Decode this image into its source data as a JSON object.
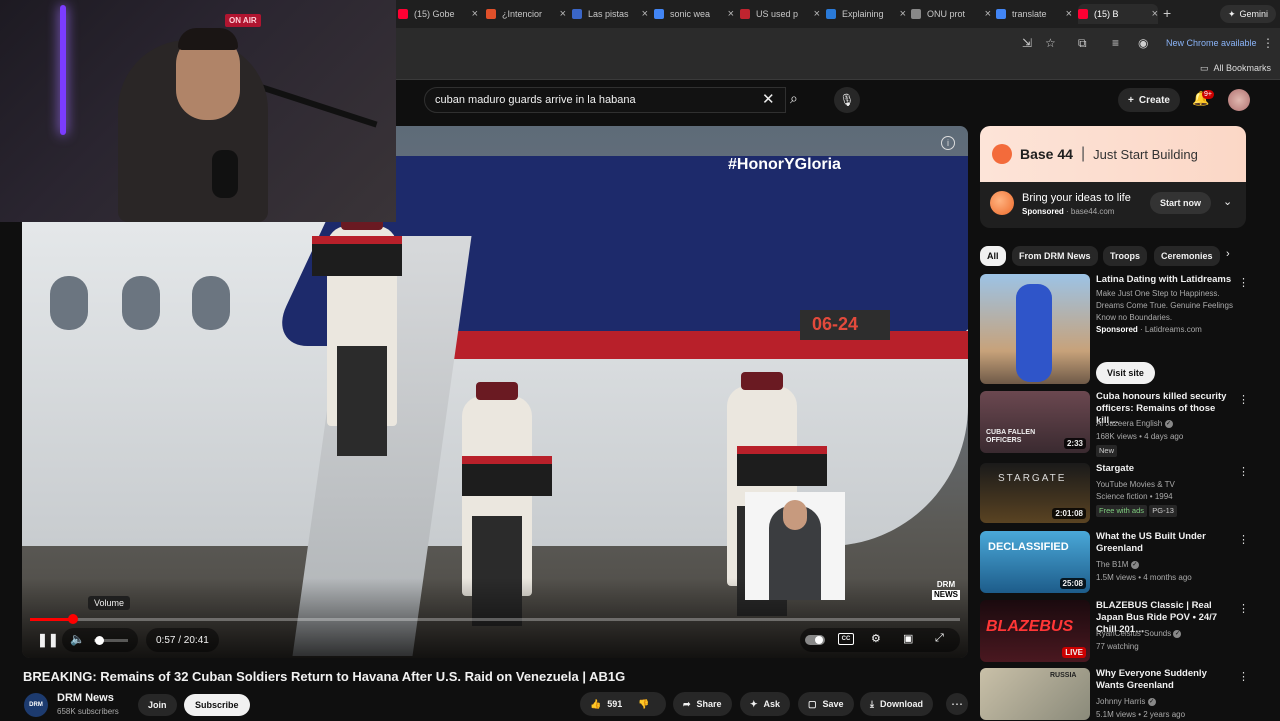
{
  "browser": {
    "tabs": [
      {
        "label": "(15) Gobe",
        "color": "#ff0033",
        "active": false
      },
      {
        "label": "¿Intencior",
        "color": "#e0502a",
        "active": false
      },
      {
        "label": "Las pistas",
        "color": "#3a66c8",
        "active": false
      },
      {
        "label": "sonic wea",
        "color": "#4285f4",
        "active": false
      },
      {
        "label": "US used p",
        "color": "#c0242f",
        "active": false
      },
      {
        "label": "Explaining",
        "color": "#2a7ad8",
        "active": false
      },
      {
        "label": "ONU prot",
        "color": "#888888",
        "active": false
      },
      {
        "label": "translate",
        "color": "#4285f4",
        "active": false
      },
      {
        "label": "(15) B",
        "color": "#ff0033",
        "active": true
      }
    ],
    "new_tab": "+",
    "gemini_label": "Gemini",
    "new_chrome": "New Chrome available",
    "all_bookmarks": "All Bookmarks",
    "close_glyph": "×"
  },
  "overlay": {
    "on_air": "ON AIR"
  },
  "youtube": {
    "search": {
      "value": "cuban maduro guards arrive in la habana"
    },
    "create_label": "Create",
    "notifications_badge": "9+"
  },
  "player": {
    "hashtag": "#HonorYGloria",
    "tail_number": "06-24",
    "watermark_top": "DRM",
    "watermark_bottom": "NEWS",
    "volume_tooltip": "Volume",
    "time": "0:57 / 20:41",
    "progress": 0.046,
    "volume": 0.15,
    "cc_label": "CC"
  },
  "video": {
    "title": "BREAKING: Remains of 32 Cuban Soldiers Return to Havana After U.S. Raid on Venezuela | AB1G",
    "channel": "DRM News",
    "channel_avatar": "DRM",
    "subscribers": "658K subscribers",
    "join": "Join",
    "subscribe": "Subscribe",
    "likes": "591",
    "share": "Share",
    "ask": "Ask",
    "save": "Save",
    "download": "Download"
  },
  "ad": {
    "brand": "Base 44",
    "separator": "|",
    "tagline": "Just Start Building",
    "title": "Bring your ideas to life",
    "sponsored": "Sponsored",
    "domain": "base44.com",
    "cta": "Start now"
  },
  "chips": [
    "All",
    "From DRM News",
    "Troops",
    "Ceremonies"
  ],
  "recommendations": [
    {
      "title": "Latina Dating with Latidreams",
      "desc": "Make Just One Step to Happiness. Dreams Come True. Genuine Feelings Know no Boundaries.",
      "sponsored": "Sponsored",
      "domain": "Latidreams.com",
      "cta": "Visit site"
    },
    {
      "title": "Cuba honours killed security officers: Remains of those kill…",
      "channel": "Al Jazeera English",
      "meta": "168K views • 4 days ago",
      "badge": "New",
      "duration": "2:33",
      "thumb_text": "CUBA FALLEN OFFICERS"
    },
    {
      "title": "Stargate",
      "channel": "YouTube Movies & TV",
      "meta": "Science fiction • 1994",
      "badge": "Free with ads",
      "badge2": "PG-13",
      "duration": "2:01:08",
      "thumb_text": "STARGATE"
    },
    {
      "title": "What the US Built Under Greenland",
      "channel": "The B1M",
      "meta": "1.5M views • 4 months ago",
      "duration": "25:08",
      "thumb_text": "DECLASSIFIED"
    },
    {
      "title": "BLAZEBUS Classic | Real Japan Bus Ride POV • 24/7 Chill 201…",
      "channel": "RyanCelsius°Sounds",
      "meta": "77 watching",
      "live": "LIVE",
      "thumb_text": "BLAZEBUS"
    },
    {
      "title": "Why Everyone Suddenly Wants Greenland",
      "channel": "Johnny Harris",
      "meta": "5.1M views • 2 years ago",
      "thumb_text": "RUSSIA"
    }
  ]
}
